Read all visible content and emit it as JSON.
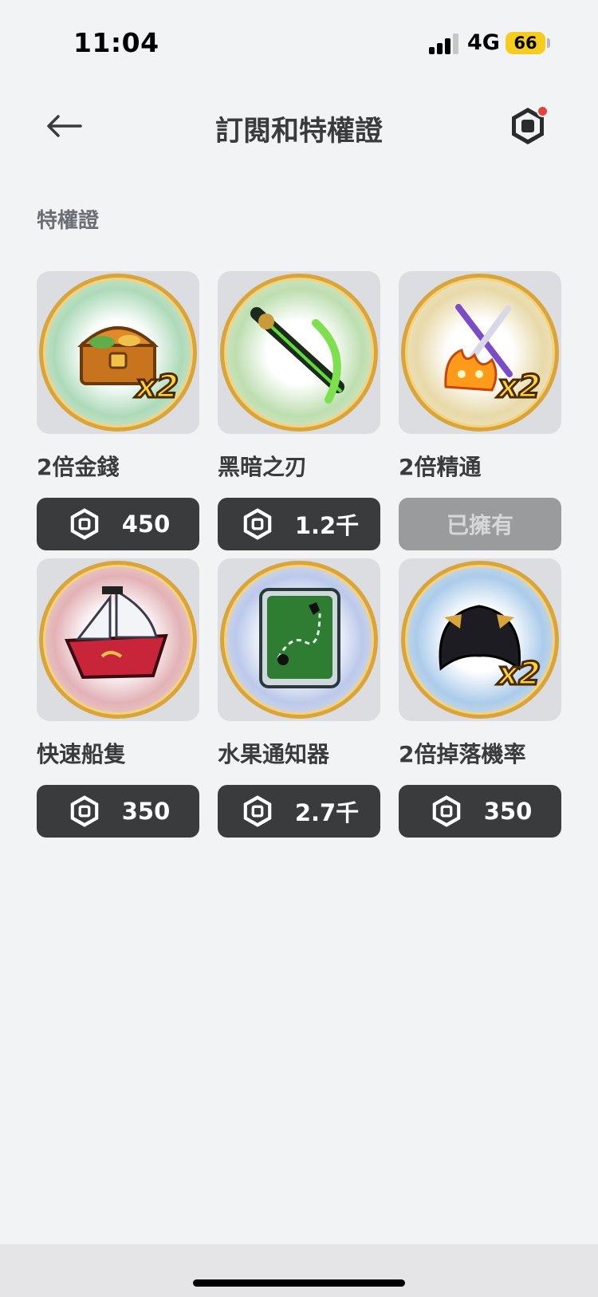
{
  "status_bar": {
    "time": "11:04",
    "network": "4G",
    "battery": "66"
  },
  "header": {
    "title": "訂閱和特權證",
    "back_icon": "arrow-left-icon",
    "currency_icon": "robux-icon",
    "has_notification": true
  },
  "section": {
    "title": "特權證"
  },
  "items": [
    {
      "name": "2倍金錢",
      "price": "450",
      "owned": false,
      "theme": "#4fd46b",
      "art": "treasure-chest-icon",
      "x2": "x2"
    },
    {
      "name": "黑暗之刃",
      "price": "1.2千",
      "owned": false,
      "theme": "#7ee04f",
      "art": "dark-blade-icon",
      "x2": ""
    },
    {
      "name": "2倍精通",
      "price": "",
      "owned": true,
      "owned_label": "已擁有",
      "theme": "#ffd23a",
      "art": "swords-fire-icon",
      "x2": "x2"
    },
    {
      "name": "快速船隻",
      "price": "350",
      "owned": false,
      "theme": "#ef5a63",
      "art": "ship-icon",
      "x2": ""
    },
    {
      "name": "水果通知器",
      "price": "2.7千",
      "owned": false,
      "theme": "#7aa0ff",
      "art": "map-card-icon",
      "x2": ""
    },
    {
      "name": "2倍掉落機率",
      "price": "350",
      "owned": false,
      "theme": "#4aa8ff",
      "art": "captain-hat-icon",
      "x2": "x2"
    }
  ],
  "colors": {
    "background": "#f2f3f5",
    "button_dark": "#393b3d",
    "button_owned": "#9a9b9d",
    "accent_badge": "#e8413a",
    "battery": "#f6cd1e"
  }
}
